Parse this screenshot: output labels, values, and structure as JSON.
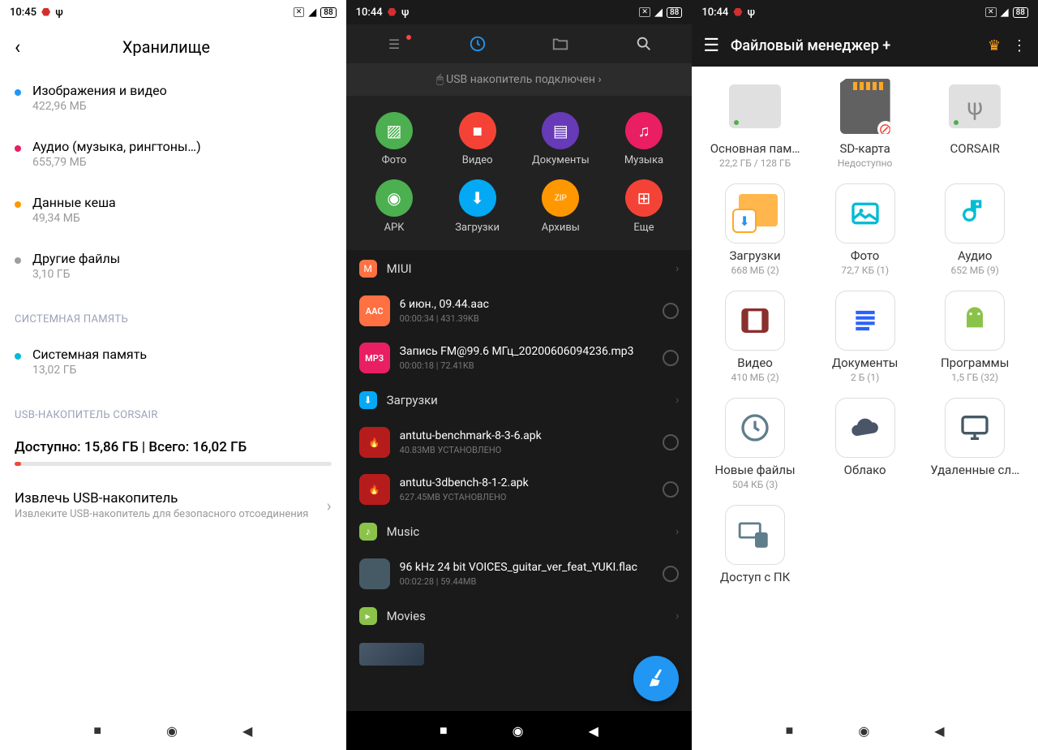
{
  "screen1": {
    "time": "10:45",
    "battery": "88",
    "title": "Хранилище",
    "items": [
      {
        "color": "#2196f3",
        "label": "Изображения и видео",
        "sub": "422,96 МБ"
      },
      {
        "color": "#e91e63",
        "label": "Аудио (музыка, рингтоны…)",
        "sub": "655,79 МБ"
      },
      {
        "color": "#ff9800",
        "label": "Данные кеша",
        "sub": "49,34 МБ"
      },
      {
        "color": "#9e9e9e",
        "label": "Другие файлы",
        "sub": "3,10 ГБ"
      }
    ],
    "sectionSystem": "СИСТЕМНАЯ ПАМЯТЬ",
    "systemItem": {
      "color": "#00bcd4",
      "label": "Системная память",
      "sub": "13,02 ГБ"
    },
    "sectionUsb": "USB-НАКОПИТЕЛЬ CORSAIR",
    "usbStatus": "Доступно: 15,86 ГБ | Всего: 16,02 ГБ",
    "ejectTitle": "Извлечь USB-накопитель",
    "ejectSub": "Извлеките USB-накопитель для безопасного отсоединения"
  },
  "screen2": {
    "time": "10:44",
    "battery": "88",
    "usbBanner": "USB накопитель подключен",
    "categories": [
      {
        "label": "Фото",
        "color": "#4caf50",
        "icon": "▨"
      },
      {
        "label": "Видео",
        "color": "#f44336",
        "icon": "■"
      },
      {
        "label": "Документы",
        "color": "#673ab7",
        "icon": "▤"
      },
      {
        "label": "Музыка",
        "color": "#e91e63",
        "icon": "♫"
      },
      {
        "label": "APK",
        "color": "#4caf50",
        "icon": "◉"
      },
      {
        "label": "Загрузки",
        "color": "#03a9f4",
        "icon": "⬇"
      },
      {
        "label": "Архивы",
        "color": "#ff9800",
        "icon": "ZIP"
      },
      {
        "label": "Еще",
        "color": "#f44336",
        "icon": "⊞"
      }
    ],
    "sections": [
      {
        "icon": "M",
        "iconColor": "#ff7043",
        "label": "MIUI",
        "files": [
          {
            "name": "6 июн., 09.44.aac",
            "meta": "00:00:34  |  431.39KB",
            "iconText": "AAC",
            "iconColor": "#ff7043"
          },
          {
            "name": "Запись FM@99.6 МГц_20200606094236.mp3",
            "meta": "00:00:18  |  72.41KB",
            "iconText": "MP3",
            "iconColor": "#e91e63"
          }
        ]
      },
      {
        "icon": "⬇",
        "iconColor": "#03a9f4",
        "label": "Загрузки",
        "files": [
          {
            "name": "antutu-benchmark-8-3-6.apk",
            "meta": "40.83MB    УСТАНОВЛЕНО",
            "iconText": "",
            "iconColor": "#b71c1c"
          },
          {
            "name": "antutu-3dbench-8-1-2.apk",
            "meta": "627.45MB    УСТАНОВЛЕНО",
            "iconText": "",
            "iconColor": "#b71c1c"
          }
        ]
      },
      {
        "icon": "♪",
        "iconColor": "#8bc34a",
        "label": "Music",
        "files": [
          {
            "name": "96 kHz 24 bit VOICES_guitar_ver_feat_YUKI.flac",
            "meta": "00:02:28  |  59.44MB",
            "iconText": "",
            "iconColor": "#455a64",
            "thumb": true
          }
        ]
      },
      {
        "icon": "▸",
        "iconColor": "#8bc34a",
        "label": "Movies",
        "files": []
      }
    ]
  },
  "screen3": {
    "time": "10:44",
    "battery": "88",
    "title": "Файловый менеджер +",
    "storage": [
      {
        "type": "drive",
        "label": "Основная пам…",
        "sub": "22,2 ГБ / 128 ГБ"
      },
      {
        "type": "sd",
        "label": "SD-карта",
        "sub": "Недоступно"
      },
      {
        "type": "usb",
        "label": "CORSAIR",
        "sub": ""
      }
    ],
    "items": [
      {
        "label": "Загрузки",
        "sub": "668 МБ (2)",
        "color": "#ffa726",
        "icon": "folder-dl"
      },
      {
        "label": "Фото",
        "sub": "72,7 КБ (1)",
        "color": "#00bcd4",
        "icon": "image"
      },
      {
        "label": "Аудио",
        "sub": "652 МБ (9)",
        "color": "#00bcd4",
        "icon": "music"
      },
      {
        "label": "Видео",
        "sub": "410 МБ (2)",
        "color": "#8b2e2e",
        "icon": "video"
      },
      {
        "label": "Документы",
        "sub": "2 Б (1)",
        "color": "#2962ff",
        "icon": "doc"
      },
      {
        "label": "Программы",
        "sub": "1,5 ГБ (32)",
        "color": "#8bc34a",
        "icon": "android"
      },
      {
        "label": "Новые файлы",
        "sub": "504 КБ (3)",
        "color": "#607d8b",
        "icon": "clock"
      },
      {
        "label": "Облако",
        "sub": "",
        "color": "#4a5568",
        "icon": "cloud"
      },
      {
        "label": "Удаленные сл…",
        "sub": "",
        "color": "#455a64",
        "icon": "monitor"
      },
      {
        "label": "Доступ с ПК",
        "sub": "",
        "color": "#607d8b",
        "icon": "pc"
      }
    ]
  }
}
